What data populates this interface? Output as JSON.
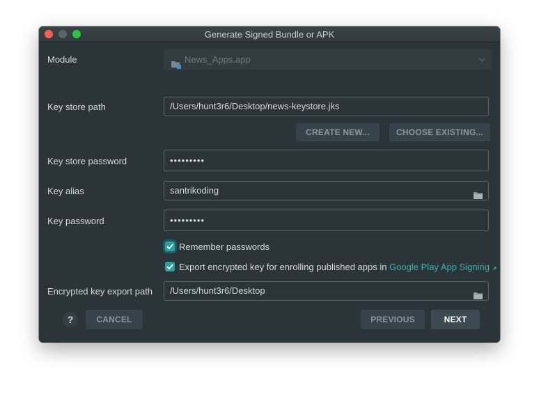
{
  "window": {
    "title": "Generate Signed Bundle or APK"
  },
  "module": {
    "label": "Module",
    "value": "News_Apps.app"
  },
  "keystore": {
    "path_label": "Key store path",
    "path_value": "/Users/hunt3r6/Desktop/news-keystore.jks",
    "create_new": "CREATE NEW...",
    "choose_existing": "CHOOSE EXISTING...",
    "password_label": "Key store password",
    "password_value": "•••••••••"
  },
  "key": {
    "alias_label": "Key alias",
    "alias_value": "santrikoding",
    "password_label": "Key password",
    "password_value": "•••••••••"
  },
  "options": {
    "remember_label": "Remember passwords",
    "remember_checked": true,
    "export_label": "Export encrypted key for enrolling published apps in",
    "export_link": "Google Play App Signing",
    "export_checked": true
  },
  "export_path": {
    "label": "Encrypted key export path",
    "value": "/Users/hunt3r6/Desktop"
  },
  "footer": {
    "help": "?",
    "cancel": "CANCEL",
    "previous": "PREVIOUS",
    "next": "NEXT"
  },
  "colors": {
    "accent": "#2aa3a0",
    "link": "#35b6b0",
    "background": "#2a3439"
  }
}
